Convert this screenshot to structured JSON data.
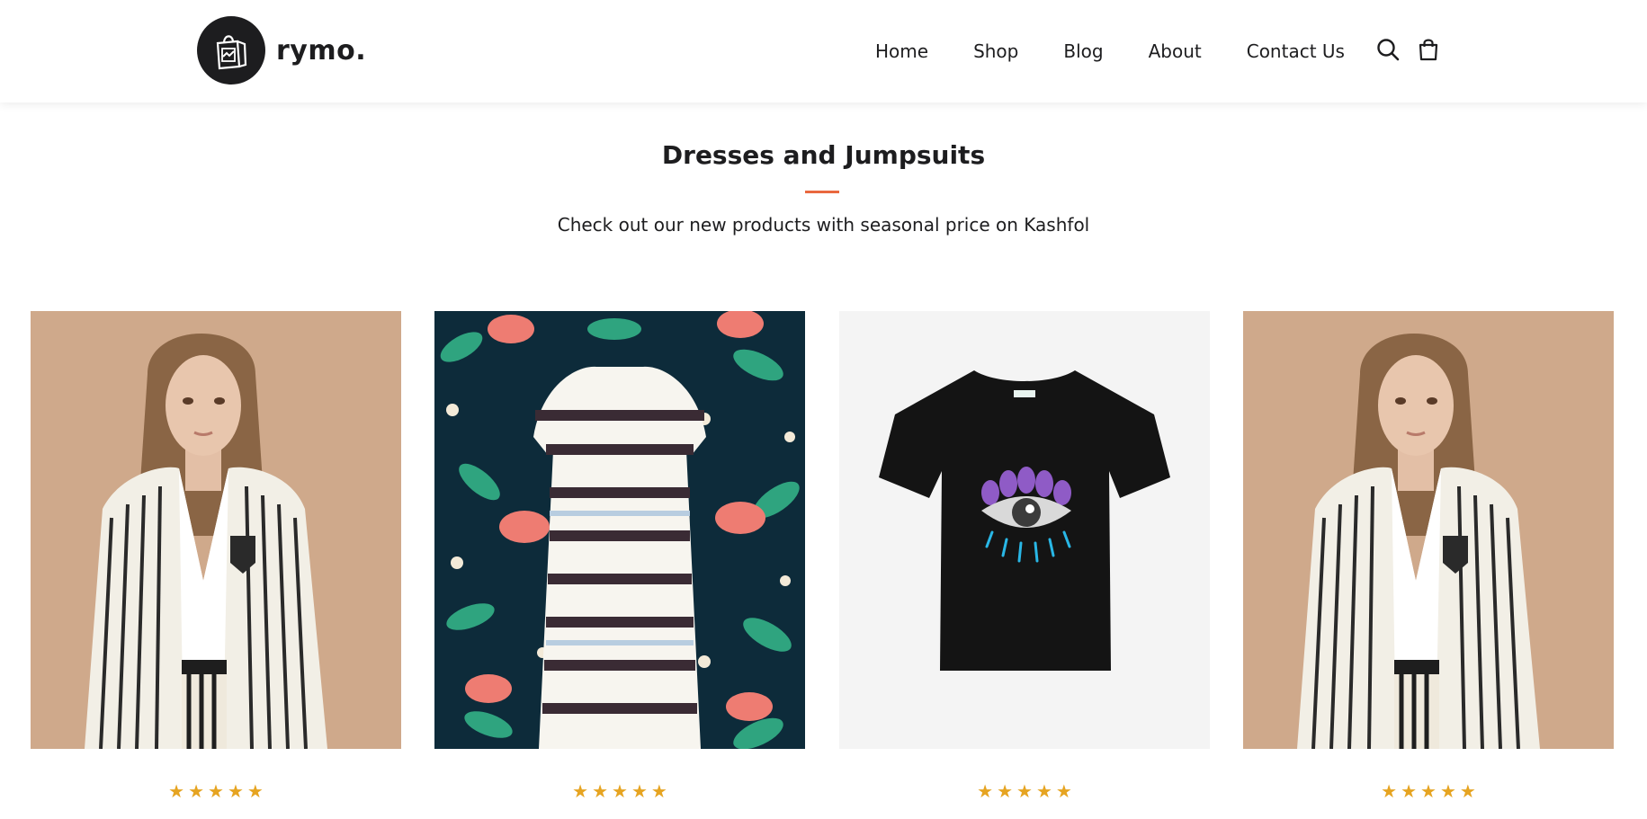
{
  "brand": {
    "name": "rymo."
  },
  "nav": {
    "items": [
      {
        "label": "Home"
      },
      {
        "label": "Shop"
      },
      {
        "label": "Blog"
      },
      {
        "label": "About"
      },
      {
        "label": "Contact Us"
      }
    ]
  },
  "icons": {
    "search": "search-icon",
    "cart": "shopping-bag-icon",
    "logo": "shopping-bag-logo-icon"
  },
  "section": {
    "title": "Dresses and Jumpsuits",
    "subtitle": "Check out our new products with seasonal price on Kashfol"
  },
  "colors": {
    "accent": "#e9683f",
    "star": "#e6a421",
    "text": "#1d1d1f"
  },
  "products": [
    {
      "image": "woman-striped-blazer-photo",
      "rating": 5
    },
    {
      "image": "striped-knit-dress-on-floral-pattern",
      "rating": 5
    },
    {
      "image": "black-eye-graphic-tshirt",
      "rating": 5
    },
    {
      "image": "woman-striped-blazer-photo",
      "rating": 5
    }
  ]
}
